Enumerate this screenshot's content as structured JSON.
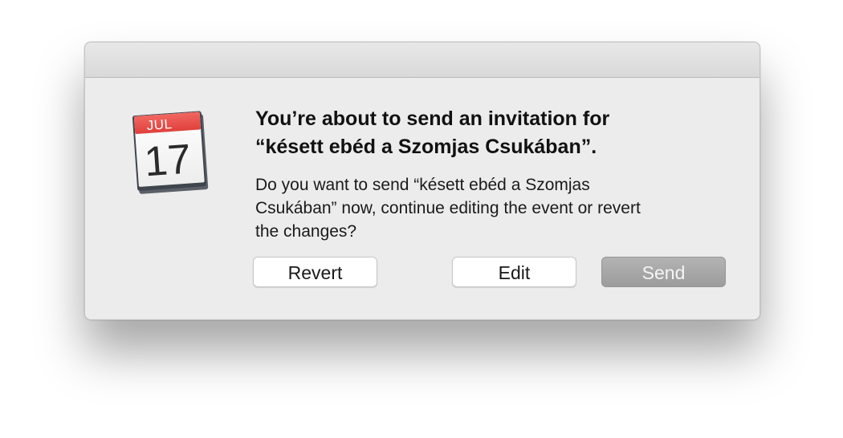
{
  "dialog": {
    "icon": "calendar-app-icon",
    "icon_month": "JUL",
    "icon_day": "17",
    "headline_line1": "You’re about to send an invitation for",
    "headline_line2": "“késett ebéd a Szomjas Csukában”.",
    "message_line1": "Do you want to send “késett ebéd a Szomjas",
    "message_line2": "Csukában” now, continue editing the event or revert",
    "message_line3": "the changes?",
    "buttons": {
      "revert": "Revert",
      "edit": "Edit",
      "send": "Send"
    }
  },
  "colors": {
    "calendar_header_red": "#e94b48",
    "primary_button_gray": "#a5a5a5"
  }
}
